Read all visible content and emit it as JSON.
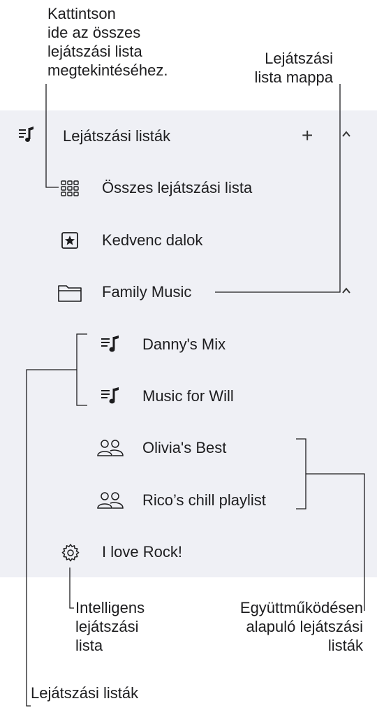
{
  "callouts": {
    "show_all": "Kattintson\nide az összes\nlejátszási lista\nmegtekintéséhez.",
    "folder": "Lejátszási\nlista mappa",
    "smart": "Intelligens\nlejátszási\nlista",
    "collab": "Együttműködésen\nalapuló lejátszási\nlisták",
    "playlists": "Lejátszási listák"
  },
  "sidebar": {
    "header": {
      "label": "Lejátszási listák",
      "add": "+",
      "collapse": "^"
    },
    "items": [
      {
        "label": "Összes lejátszási lista",
        "icon": "grid-icon"
      },
      {
        "label": "Kedvenc dalok",
        "icon": "star-icon"
      },
      {
        "label": "Family Music",
        "icon": "folder-icon",
        "expanded": true
      },
      {
        "label": "Danny's Mix",
        "icon": "playlist-icon",
        "in_folder": true
      },
      {
        "label": "Music for Will",
        "icon": "playlist-icon",
        "in_folder": true
      },
      {
        "label": "Olivia's Best",
        "icon": "people-icon",
        "in_folder": true
      },
      {
        "label": "Rico’s chill playlist",
        "icon": "people-icon",
        "in_folder": true
      },
      {
        "label": "I love Rock!",
        "icon": "gear-icon"
      }
    ]
  },
  "colors": {
    "panel": "#eff0f5",
    "text": "#1d1d1f",
    "line": "#1d1d1f"
  }
}
